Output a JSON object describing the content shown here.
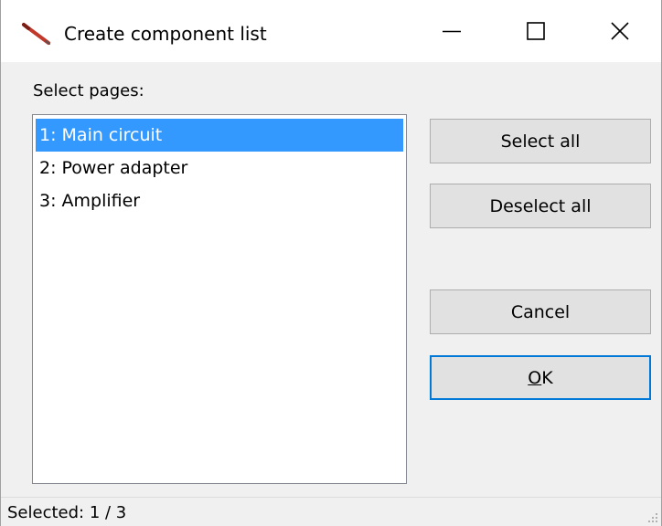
{
  "window": {
    "title": "Create component list",
    "icon": "pen-icon",
    "controls": {
      "minimize_icon": "minimize-icon",
      "maximize_icon": "maximize-icon",
      "close_icon": "close-icon"
    }
  },
  "dialog": {
    "select_label": "Select pages:",
    "pages": [
      {
        "label": "1: Main circuit",
        "selected": true
      },
      {
        "label": "2: Power adapter",
        "selected": false
      },
      {
        "label": "3: Amplifier",
        "selected": false
      }
    ],
    "buttons": {
      "select_all": "Select all",
      "deselect_all": "Deselect all",
      "cancel": "Cancel",
      "ok_accel": "O",
      "ok_rest": "K"
    }
  },
  "status": {
    "text": "Selected: 1 / 3"
  },
  "colors": {
    "selection": "#3399ff",
    "default_button_border": "#0078d7",
    "dialog_background": "#f0f0f0"
  }
}
